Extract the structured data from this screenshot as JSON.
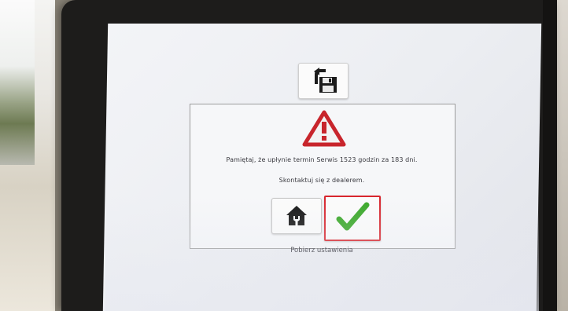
{
  "toolbar": {
    "save_icon": "save-with-back-arrow-icon"
  },
  "dialog": {
    "warning_icon": "warning-triangle-icon",
    "warning_color": "#c8252c",
    "message_line1": "Pamiętaj, że upłynie termin Serwis 1523 godzin za 183 dni.",
    "message_line2": "Skontaktuj się z dealerem.",
    "home_button_icon": "home-wrench-icon",
    "ok_button_icon": "checkmark-icon",
    "ok_color": "#3aa829",
    "ok_border_color": "#d8262e"
  },
  "footer": {
    "settings_label": "Pobierz ustawienia"
  }
}
